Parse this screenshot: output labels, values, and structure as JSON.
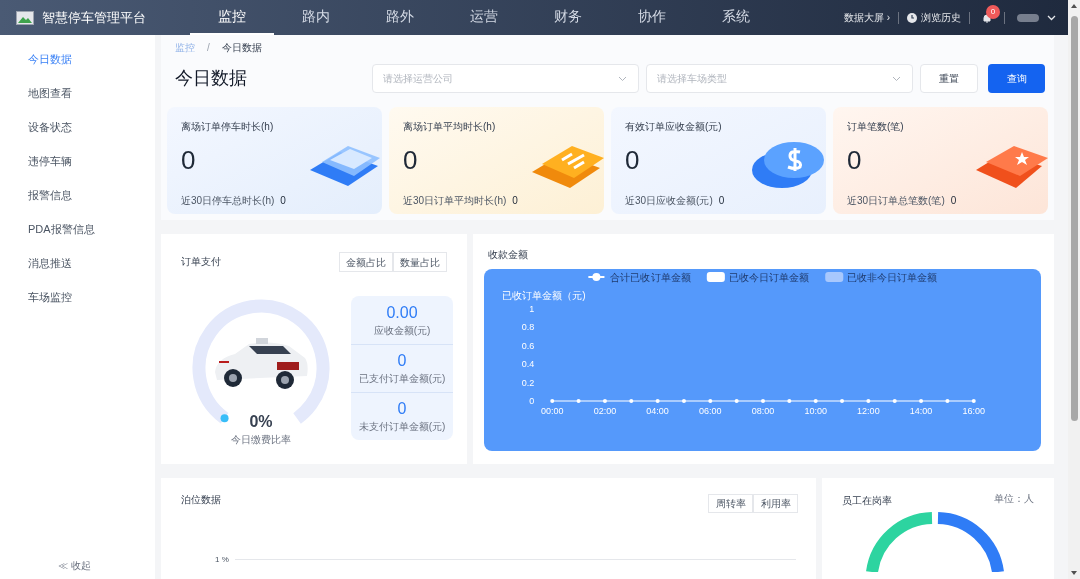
{
  "header": {
    "title": "智慧停车管理平台",
    "nav": [
      {
        "label": "监控",
        "selected": true
      },
      {
        "label": "路内",
        "selected": false
      },
      {
        "label": "路外",
        "selected": false
      },
      {
        "label": "运营",
        "selected": false
      },
      {
        "label": "财务",
        "selected": false
      },
      {
        "label": "协作",
        "selected": false
      },
      {
        "label": "系统",
        "selected": false
      }
    ],
    "big_screen": "数据大屏",
    "big_screen_arrow": "›",
    "history": "浏览历史",
    "notification_count": "0"
  },
  "sidebar": {
    "items": [
      {
        "label": "今日数据",
        "selected": true
      },
      {
        "label": "地图查看",
        "selected": false
      },
      {
        "label": "设备状态",
        "selected": false
      },
      {
        "label": "违停车辆",
        "selected": false
      },
      {
        "label": "报警信息",
        "selected": false
      },
      {
        "label": "PDA报警信息",
        "selected": false
      },
      {
        "label": "消息推送",
        "selected": false
      },
      {
        "label": "车场监控",
        "selected": false
      }
    ],
    "collapse": "收起",
    "collapse_glyph": "≪"
  },
  "breadcrumb": [
    "监控",
    "/",
    "今日数据"
  ],
  "page_title": "今日数据",
  "filters": [
    {
      "placeholder": "请选择运营公司"
    },
    {
      "placeholder": "请选择车场类型"
    }
  ],
  "buttons": [
    {
      "label": "重置",
      "kind": "secondary"
    },
    {
      "label": "查询",
      "kind": "primary"
    }
  ],
  "stat_cards": [
    {
      "title": "离场订单停车时长(h)",
      "value": "0",
      "sub_label": "近30日停车总时长(h)",
      "sub_value": "0",
      "kind": "tablet"
    },
    {
      "title": "离场订单平均时长(h)",
      "value": "0",
      "sub_label": "近30日订单平均时长(h)",
      "sub_value": "0",
      "kind": "document"
    },
    {
      "title": "有效订单应收金额(元)",
      "value": "0",
      "sub_label": "近30日应收金额(元)",
      "sub_value": "0",
      "kind": "coin"
    },
    {
      "title": "订单笔数(笔)",
      "value": "0",
      "sub_label": "近30日订单总笔数(笔)",
      "sub_value": "0",
      "kind": "ticket"
    }
  ],
  "order_payment": {
    "title": "订单支付",
    "toggles": [
      "金额占比",
      "数量占比"
    ],
    "gauge": {
      "level": 0,
      "value": "0%",
      "label": "今日缴费比率"
    },
    "metrics": [
      {
        "value": "0.00",
        "label": "应收金额(元)"
      },
      {
        "value": "0",
        "label": "已支付订单金额(元)"
      },
      {
        "value": "0",
        "label": "未支付订单金额(元)"
      }
    ]
  },
  "collections": {
    "title": "收款金额",
    "chart_data": {
      "type": "line",
      "ylabel": "已收订单金额（元)",
      "x": [
        0,
        1,
        2,
        3,
        4,
        5,
        6,
        7,
        8,
        9,
        10,
        11,
        12,
        13,
        14,
        15,
        16
      ],
      "legend": true,
      "xlim": [
        0,
        16
      ],
      "xticks": [
        {
          "value": 0,
          "label": "00:00"
        },
        {
          "value": 2,
          "label": "02:00"
        },
        {
          "value": 4,
          "label": "04:00"
        },
        {
          "value": 6,
          "label": "06:00"
        },
        {
          "value": 8,
          "label": "08:00"
        },
        {
          "value": 10,
          "label": "10:00"
        },
        {
          "value": 12,
          "label": "12:00"
        },
        {
          "value": 14,
          "label": "14:00"
        },
        {
          "value": 16,
          "label": "16:00"
        }
      ],
      "ylim": [
        0,
        1
      ],
      "yticks": [
        0,
        0.2,
        0.4,
        0.6,
        0.8,
        1
      ],
      "series": [
        {
          "name": "合计已收订单金额",
          "color": "#ffffff",
          "values": [
            0,
            0,
            0,
            0,
            0,
            0,
            0,
            0,
            0,
            0,
            0,
            0,
            0,
            0,
            0,
            0,
            0
          ]
        }
      ]
    },
    "extra_legend": [
      {
        "name": "已收今日订单金额",
        "color": "#ffffff"
      },
      {
        "name": "已收非今日订单金额",
        "color": "#a8c8fd"
      }
    ]
  },
  "berth": {
    "title": "泊位数据",
    "toggles": [
      "周转率",
      "利用率"
    ],
    "y_tick": "1 %"
  },
  "staff": {
    "title": "员工在岗率",
    "unit": "单位：人"
  }
}
